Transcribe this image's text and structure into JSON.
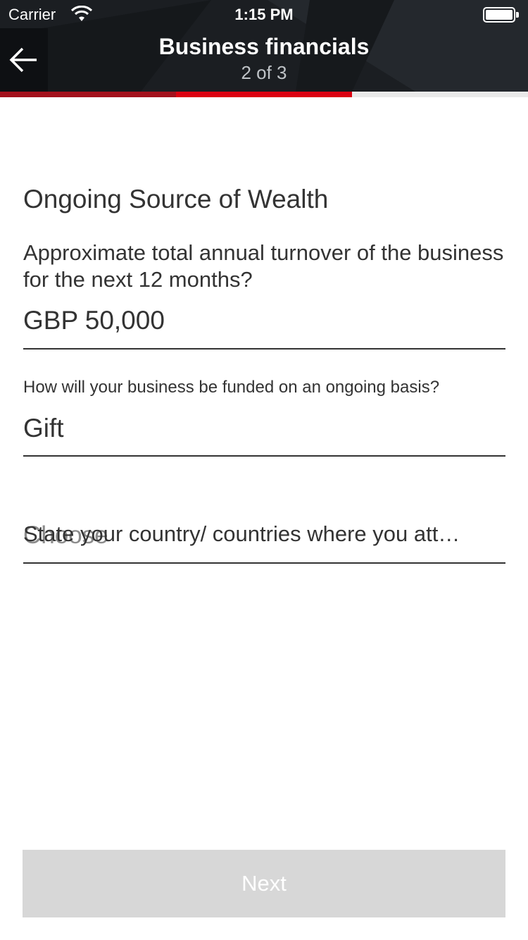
{
  "status_bar": {
    "carrier": "Carrier",
    "time": "1:15 PM"
  },
  "header": {
    "title": "Business financials",
    "step": "2 of 3",
    "back_icon": "arrow-left-icon"
  },
  "progress": {
    "current_step": 2,
    "total_steps": 3,
    "completed_color": "#a3111c",
    "active_color": "#db0011"
  },
  "form": {
    "section_title": "Ongoing Source of Wealth",
    "turnover_label": "Approximate total annual turnover of the business for the next 12 months?",
    "turnover_value": "GBP 50,000",
    "funding_label": "How will your business be funded on an ongoing basis?",
    "funding_value": "Gift",
    "country_placeholder": "State your country/ countries where you att…",
    "country_choose": "Choose"
  },
  "footer": {
    "next_label": "Next"
  }
}
